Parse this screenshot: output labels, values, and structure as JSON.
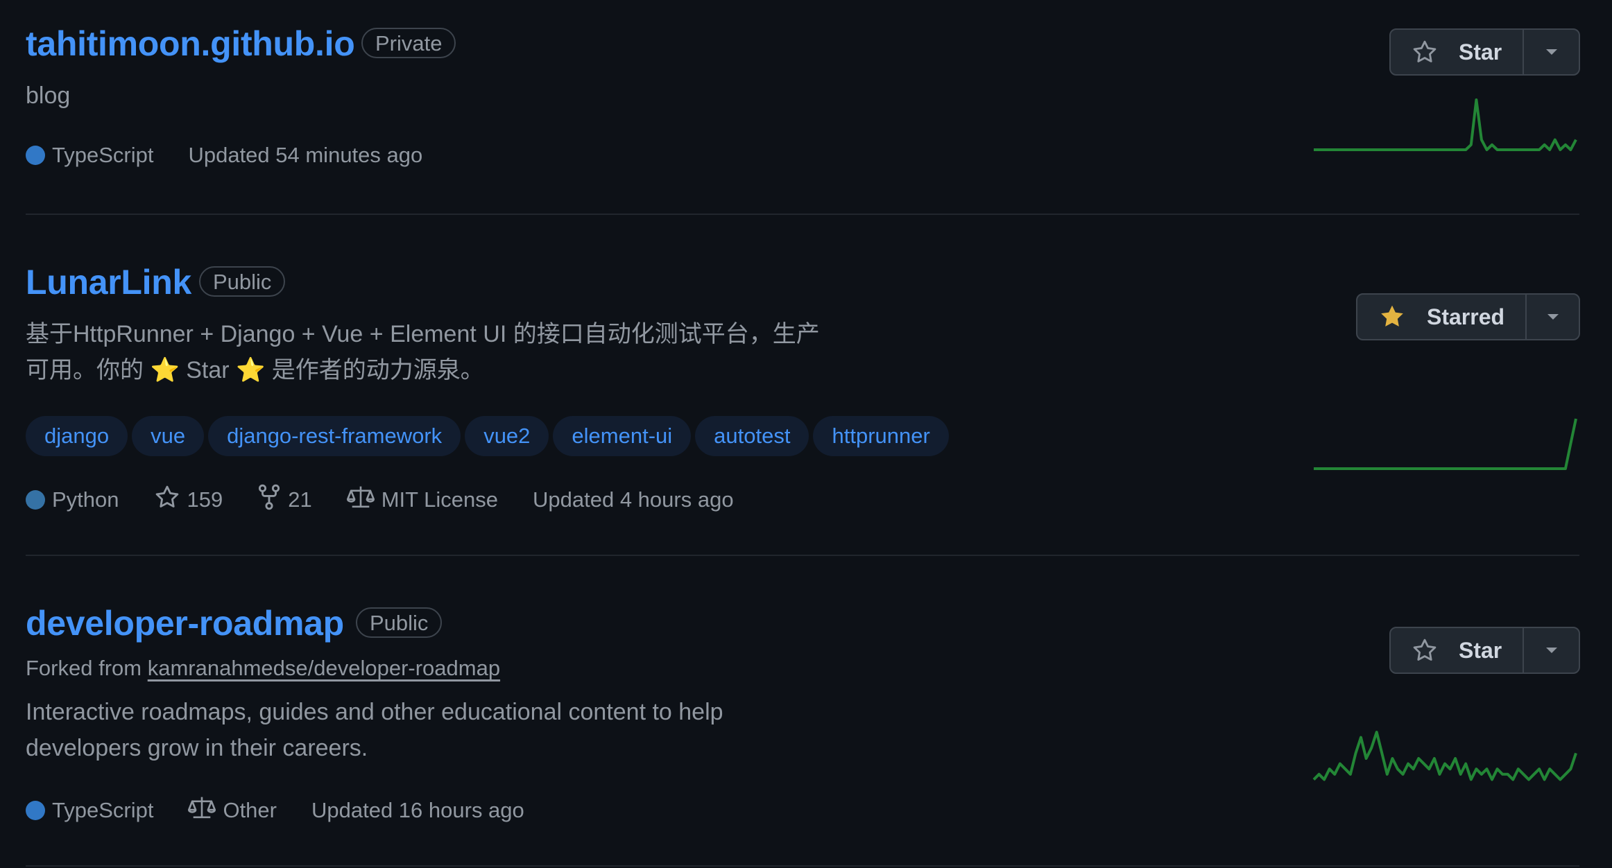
{
  "repos": [
    {
      "name": "tahitimoon.github.io",
      "visibility": "Private",
      "description_lines": [
        "blog"
      ],
      "language": "TypeScript",
      "language_color": "#3178c6",
      "updated": "Updated 54 minutes ago",
      "star_button": "Star",
      "sparkline": [
        0,
        0,
        0,
        0,
        0,
        0,
        0,
        0,
        0,
        0,
        0,
        0,
        0,
        0,
        0,
        0,
        0,
        0,
        0,
        0,
        0,
        0,
        0,
        0,
        0,
        0,
        0,
        0,
        0,
        0,
        1,
        10,
        2,
        0,
        1,
        0,
        0,
        0,
        0,
        0,
        0,
        0,
        0,
        0,
        1,
        0,
        2,
        0,
        1,
        0,
        2
      ]
    },
    {
      "name": "LunarLink",
      "visibility": "Public",
      "description_lines": [
        "基于HttpRunner + Django + Vue + Element UI 的接口自动化测试平台，生产",
        "可用。你的 ⭐ Star ⭐ 是作者的动力源泉。"
      ],
      "topics": [
        "django",
        "vue",
        "django-rest-framework",
        "vue2",
        "element-ui",
        "autotest",
        "httprunner"
      ],
      "language": "Python",
      "language_color": "#3572A5",
      "stars": "159",
      "forks": "21",
      "license": "MIT License",
      "updated": "Updated 4 hours ago",
      "star_button": "Starred",
      "sparkline": [
        0,
        0,
        0,
        0,
        0,
        0,
        0,
        0,
        0,
        0,
        0,
        0,
        0,
        0,
        0,
        0,
        0,
        0,
        0,
        0,
        0,
        0,
        0,
        0,
        0,
        0,
        0,
        0,
        0,
        0,
        0,
        0,
        0,
        0,
        0,
        0,
        0,
        0,
        0,
        0,
        0,
        0,
        0,
        0,
        0,
        0,
        0,
        0,
        0,
        4,
        8
      ]
    },
    {
      "name": "developer-roadmap",
      "visibility": "Public",
      "forked_prefix": "Forked from",
      "forked_from": "kamranahmedse/developer-roadmap",
      "description_lines": [
        "Interactive roadmaps, guides and other educational content to help",
        "developers grow in their careers."
      ],
      "language": "TypeScript",
      "language_color": "#3178c6",
      "license": "Other",
      "updated": "Updated 16 hours ago",
      "star_button": "Star",
      "sparkline": [
        1,
        2,
        1,
        3,
        2,
        4,
        3,
        2,
        6,
        9,
        5,
        7,
        10,
        6,
        2,
        5,
        3,
        2,
        4,
        3,
        5,
        4,
        3,
        5,
        2,
        4,
        3,
        5,
        2,
        4,
        1,
        3,
        2,
        3,
        1,
        3,
        2,
        2,
        1,
        3,
        2,
        1,
        2,
        3,
        1,
        3,
        2,
        1,
        2,
        3,
        6
      ]
    }
  ],
  "colors": {
    "link": "#4493f8",
    "spark": "#238636",
    "star_gold": "#e3b341"
  }
}
